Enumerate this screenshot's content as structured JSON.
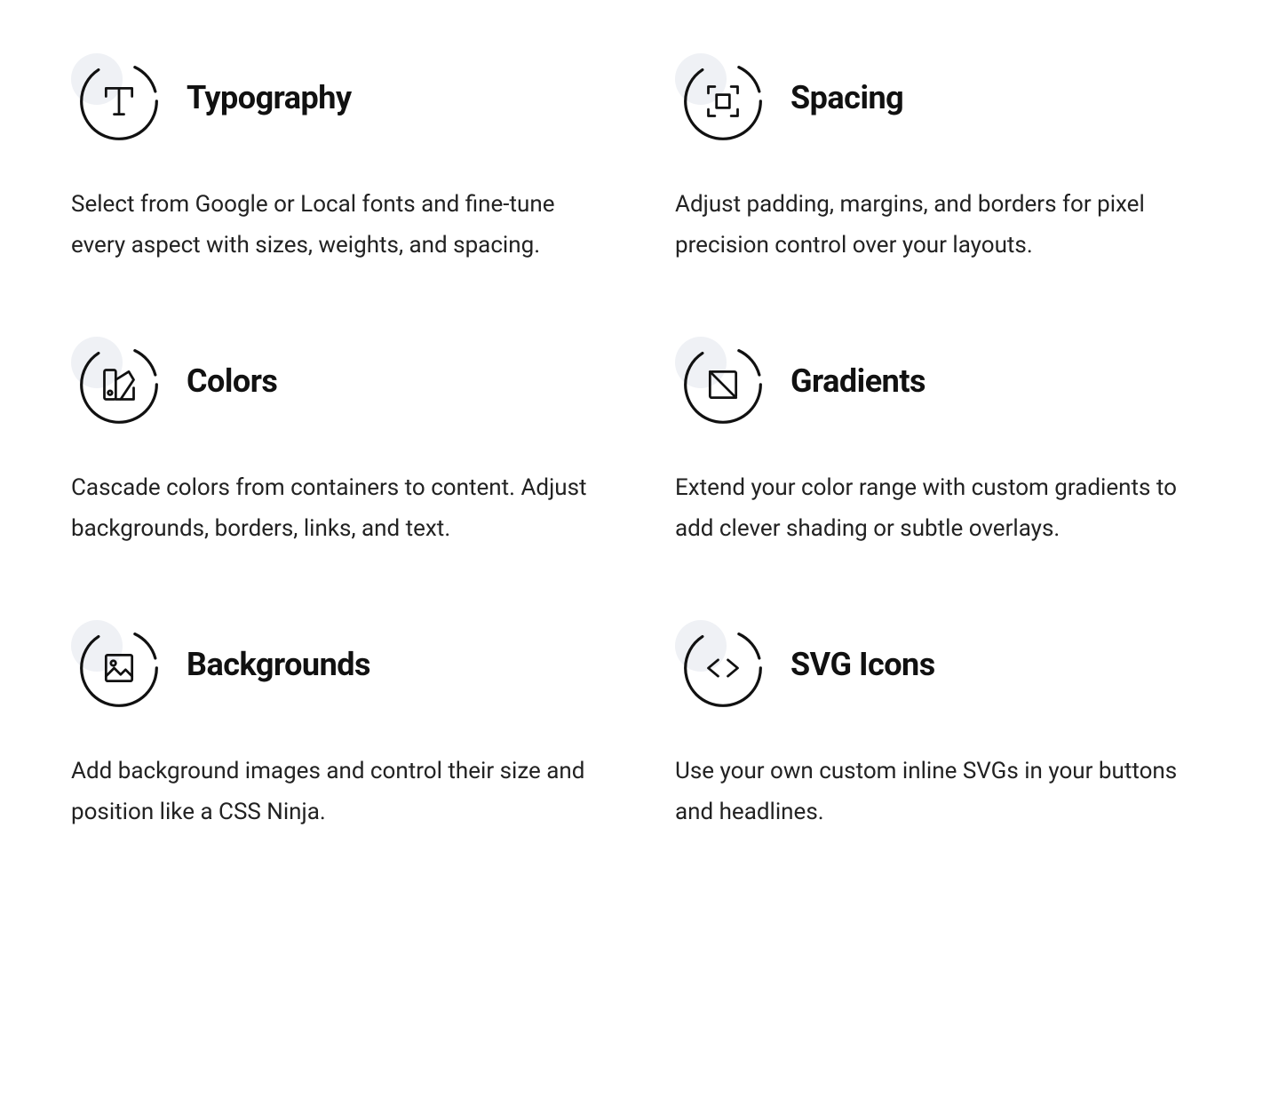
{
  "features": [
    {
      "icon": "typography-icon",
      "title": "Typography",
      "desc": "Select from Google or Local fonts and fine-tune every aspect with sizes, weights, and spacing."
    },
    {
      "icon": "spacing-icon",
      "title": "Spacing",
      "desc": "Adjust padding, margins, and borders for pixel precision control over your layouts."
    },
    {
      "icon": "colors-icon",
      "title": "Colors",
      "desc": "Cascade colors from containers to content. Adjust backgrounds, borders, links, and text."
    },
    {
      "icon": "gradients-icon",
      "title": "Gradients",
      "desc": "Extend your color range with custom gradients to add clever shading or subtle overlays."
    },
    {
      "icon": "backgrounds-icon",
      "title": "Backgrounds",
      "desc": "Add background images and control their size and position like a CSS Ninja."
    },
    {
      "icon": "svg-icons-icon",
      "title": "SVG Icons",
      "desc": "Use your own custom inline SVGs in your buttons and headlines."
    }
  ]
}
